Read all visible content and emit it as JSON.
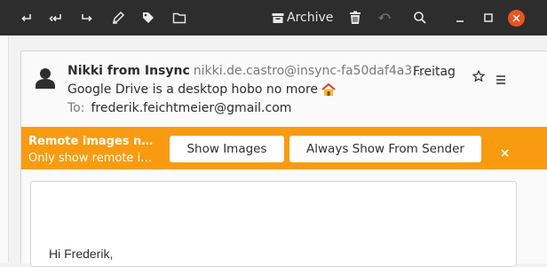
{
  "toolbar": {
    "archive_label": "Archive",
    "icons": [
      "reply-icon",
      "reply-all-icon",
      "forward-icon",
      "pen-icon",
      "tag-icon",
      "folder-icon",
      "archive-icon",
      "trash-icon",
      "undo-icon",
      "search-icon",
      "minimize-icon",
      "maximize-icon",
      "close-icon"
    ]
  },
  "message": {
    "sender_name": "Nikki from Insync",
    "sender_email": "nikki.de.castro@insync-fa50daf4a3…",
    "date": "Freitag",
    "subject": "Google Drive is a desktop hobo no more",
    "to_label": "To:",
    "to_address": "frederik.feichtmeier@gmail.com"
  },
  "banner": {
    "title": "Remote images n…",
    "subtitle": "Only show remote i…",
    "show_images": "Show Images",
    "always_show": "Always Show From Sender",
    "color": "#f99b11"
  },
  "body": {
    "greeting": "Hi Frederik,"
  },
  "colors": {
    "titlebar": "#2d2d2d",
    "close": "#e95420",
    "accent": "#f99b11"
  }
}
